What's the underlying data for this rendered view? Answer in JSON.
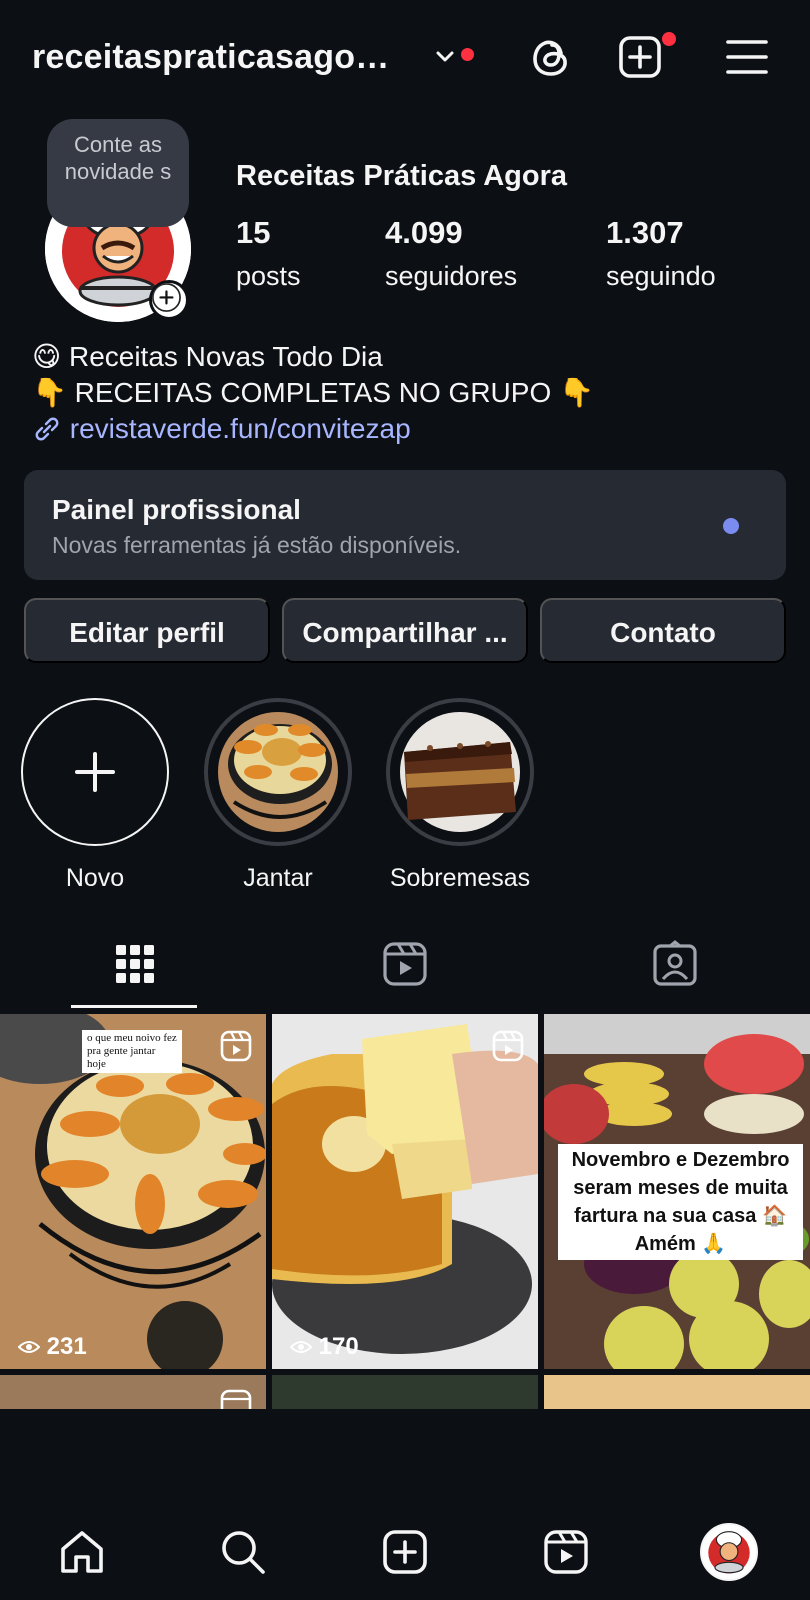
{
  "header": {
    "username": "receitaspraticasago…",
    "icons": [
      "chevron-down-icon",
      "threads-icon",
      "new-post-icon",
      "menu-icon"
    ]
  },
  "profile": {
    "bubble": "Conte as novidade s",
    "name": "Receitas Práticas Agora",
    "stats": [
      {
        "value": "15",
        "label": "posts"
      },
      {
        "value": "4.099",
        "label": "seguidores"
      },
      {
        "value": "1.307",
        "label": "seguindo"
      }
    ],
    "bio": [
      "😋 Receitas Novas Todo Dia",
      "👇 RECEITAS COMPLETAS NO GRUPO 👇"
    ],
    "link": "revistaverde.fun/convitezap"
  },
  "pro_panel": {
    "title": "Painel profissional",
    "subtitle": "Novas ferramentas já estão disponíveis."
  },
  "buttons": {
    "edit": "Editar perfil",
    "share": "Compartilhar ...",
    "contact": "Contato"
  },
  "highlights": [
    {
      "label": "Novo"
    },
    {
      "label": "Jantar"
    },
    {
      "label": "Sobremesas"
    }
  ],
  "tabs": [
    "grid-icon",
    "reels-icon",
    "tagged-icon"
  ],
  "posts": [
    {
      "note": "o que meu noivo fez pra gente jantar hoje",
      "views": "231"
    },
    {
      "views": "170"
    },
    {
      "caption": "Novembro e Dezembro seram meses de muita fartura na sua casa 🏠 Amém 🙏"
    }
  ],
  "nav": [
    "home-icon",
    "search-icon",
    "create-icon",
    "reels-icon",
    "profile-avatar"
  ],
  "colors": {
    "background": "#0c0f14",
    "panel": "#262a33",
    "link": "#a8b6ff",
    "notification": "#ff3040",
    "pro_dot": "#7a8cf0"
  }
}
